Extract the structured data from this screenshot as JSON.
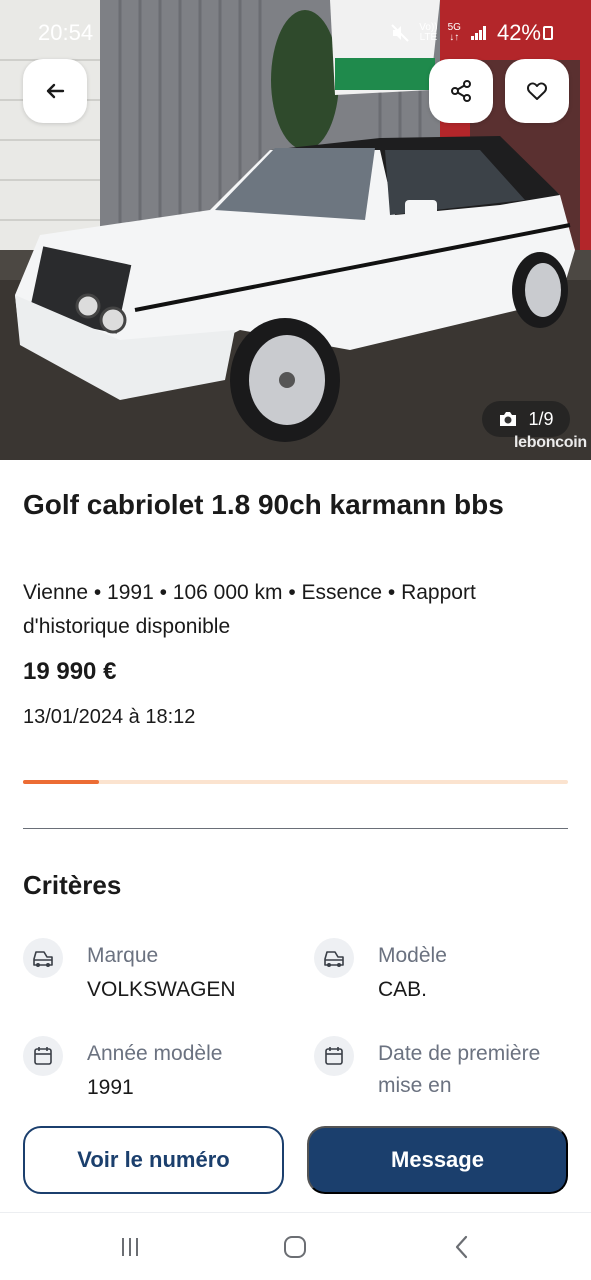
{
  "status_bar": {
    "time": "20:54",
    "network_top": "Vo))",
    "network_bottom": "LTE",
    "network5g_top": "5G",
    "network5g_bottom": "↓↑",
    "battery": "42%"
  },
  "header": {
    "back_icon": "arrow-left-icon",
    "share_icon": "share-icon",
    "favorite_icon": "heart-icon",
    "photo_counter": "1/9",
    "camera_icon": "camera-icon",
    "watermark": "leboncoin"
  },
  "listing": {
    "title": "Golf cabriolet 1.8 90ch karmann bbs",
    "meta": "Vienne • 1991 • 106 000 km • Essence • Rapport d'historique disponible",
    "price": "19 990 €",
    "date": "13/01/2024 à 18:12",
    "progress_fraction": 0.14
  },
  "criteria": {
    "title": "Critères",
    "items": [
      {
        "label": "Marque",
        "value": "VOLKSWAGEN",
        "icon": "car-icon"
      },
      {
        "label": "Modèle",
        "value": "CAB.",
        "icon": "car-icon"
      },
      {
        "label": "Année modèle",
        "value": "1991",
        "icon": "calendar-icon"
      },
      {
        "label": "Date de première mise en",
        "value": "",
        "icon": "calendar-icon"
      }
    ]
  },
  "actions": {
    "call_label": "Voir le numéro",
    "message_label": "Message"
  },
  "nav": {
    "recents_icon": "recents-icon",
    "home_icon": "home-icon",
    "back_icon": "back-chevron-icon"
  },
  "colors": {
    "primary": "#1b3f6d",
    "accent": "#ec6c34",
    "accent_light": "#fbe3cf"
  }
}
